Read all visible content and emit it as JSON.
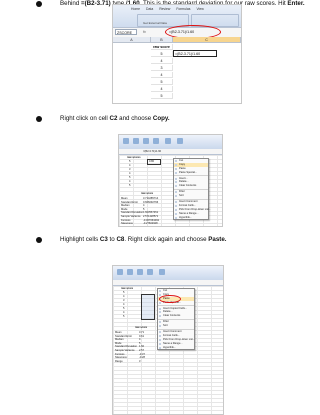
{
  "steps": [
    {
      "parts": [
        {
          "t": "Behind "
        },
        {
          "t": "=(B2-3.71)",
          "b": true
        },
        {
          "t": " type "
        },
        {
          "t": "/1.60",
          "b": true
        },
        {
          "t": ". This is the standard deviation for our raw scores. Hit "
        },
        {
          "t": "Enter.",
          "b": true
        }
      ]
    },
    {
      "parts": [
        {
          "t": "Right click on cell "
        },
        {
          "t": "C2",
          "b": true
        },
        {
          "t": " and choose "
        },
        {
          "t": "Copy.",
          "b": true
        }
      ]
    },
    {
      "parts": [
        {
          "t": "Highlight cells "
        },
        {
          "t": "C3",
          "b": true
        },
        {
          "t": " to "
        },
        {
          "t": "C8",
          "b": true
        },
        {
          "t": ". Right click again and choose "
        },
        {
          "t": "Paste.",
          "b": true
        }
      ]
    }
  ],
  "shot1": {
    "tabs": [
      "Home",
      "Data",
      "Review",
      "Formulas",
      "View",
      "Get External Data"
    ],
    "name_box": "ZSCORE",
    "formula": "=(B2-3.71)/1.60",
    "columns": [
      "A",
      "B",
      "C"
    ],
    "header": "raw score",
    "values": [
      "5",
      "4",
      "3",
      "4",
      "5",
      "4",
      "5"
    ],
    "edit_cell": "=(B2-3.71)/1.60"
  },
  "shot2": {
    "formula": "=(B2-3.71)/1.60",
    "header": "raw scores",
    "values": [
      "5",
      "4",
      "3",
      "4",
      "5",
      "4",
      "5"
    ],
    "c2_value": "0.80",
    "menu": [
      "Cut",
      "Copy",
      "Paste",
      "Paste Special...",
      "Insert...",
      "Delete...",
      "Clear Contents",
      "Filter",
      "Sort",
      "Insert Comment",
      "Format Cells...",
      "Pick From Drop-down List...",
      "Name a Range...",
      "Hyperlink..."
    ],
    "stats_header": "raw score",
    "stats": [
      {
        "label": "Mean",
        "value": "3.714285714"
      },
      {
        "label": "Standard Error",
        "value": "0.606092796"
      },
      {
        "label": "Median",
        "value": "4"
      },
      {
        "label": "Mode",
        "value": "5"
      },
      {
        "label": "Standard Deviation",
        "value": "1.603567451"
      },
      {
        "label": "Sample Variance",
        "value": "2.571428571"
      },
      {
        "label": "Kurtosis",
        "value": "-0.367063492"
      },
      {
        "label": "Skewness",
        "value": "-0.27602928"
      }
    ]
  },
  "shot3": {
    "header": "raw score",
    "values": [
      "5",
      "4",
      "3",
      "4",
      "5",
      "4",
      "5"
    ],
    "menu": [
      "Cut",
      "Copy",
      "Paste",
      "Paste Special...",
      "Insert Copied Cells...",
      "Delete...",
      "Clear Contents",
      "Filter",
      "Sort",
      "Insert Comment",
      "Format Cells...",
      "Pick From Drop-down List...",
      "Name a Range...",
      "Hyperlink..."
    ],
    "stats_header": "raw score",
    "stats": [
      {
        "label": "Mean",
        "value": "3.71"
      },
      {
        "label": "Standard Error",
        "value": "0.61"
      },
      {
        "label": "Median",
        "value": "4"
      },
      {
        "label": "Mode",
        "value": "5"
      },
      {
        "label": "Standard Deviation",
        "value": "1.60"
      },
      {
        "label": "Sample Variance",
        "value": "2.57"
      },
      {
        "label": "Kurtosis",
        "value": "-0.37"
      },
      {
        "label": "Skewness",
        "value": "-0.28"
      },
      {
        "label": "Range",
        "value": "3"
      }
    ]
  }
}
